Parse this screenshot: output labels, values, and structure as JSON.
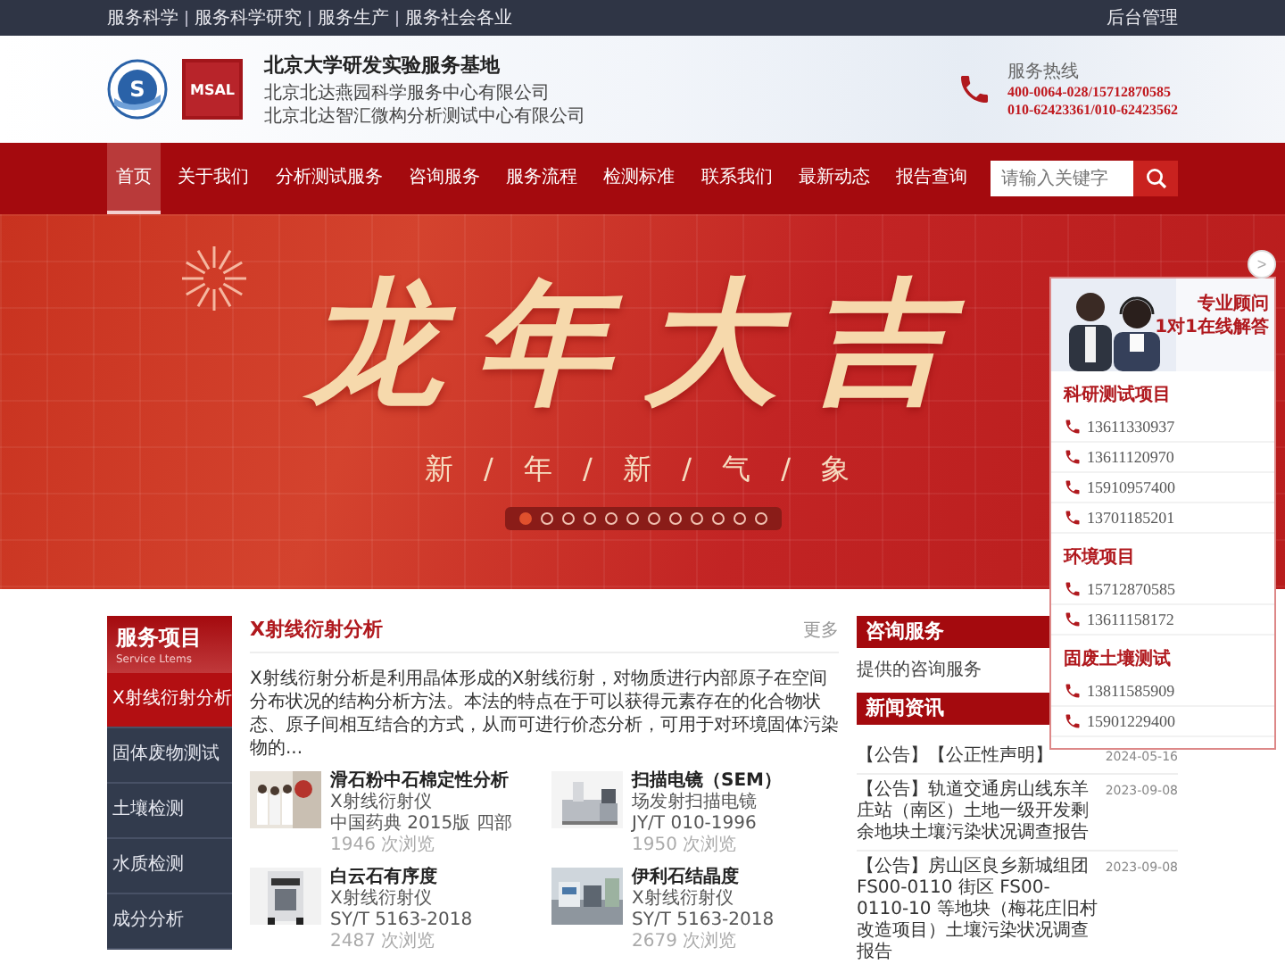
{
  "top_bar": {
    "links": [
      "服务科学",
      "服务科学研究",
      "服务生产",
      "服务社会各业"
    ],
    "admin_link": "后台管理"
  },
  "header": {
    "emblem_letter": "S",
    "logo_text": "MSAL",
    "title": "北京大学研发实验服务基地",
    "companies": [
      "北京北达燕园科学服务中心有限公司",
      "北京北达智汇微构分析测试中心有限公司"
    ],
    "hotline": {
      "label": "服务热线",
      "numbers": [
        "400-0064-028/15712870585",
        "010-62423361/010-62423562"
      ]
    }
  },
  "nav": {
    "items": [
      {
        "label": "首页",
        "selected": true
      },
      {
        "label": "关于我们",
        "selected": false
      },
      {
        "label": "分析测试服务",
        "selected": false
      },
      {
        "label": "咨询服务",
        "selected": false
      },
      {
        "label": "服务流程",
        "selected": false
      },
      {
        "label": "检测标准",
        "selected": false
      },
      {
        "label": "联系我们",
        "selected": false
      },
      {
        "label": "最新动态",
        "selected": false
      },
      {
        "label": "报告查询",
        "selected": false
      }
    ],
    "search": {
      "placeholder": "请输入关键字"
    }
  },
  "banner": {
    "headline": "龙年大吉",
    "subtitle": "新 / 年 / 新 / 气 / 象",
    "slides": [
      {
        "selected": true
      },
      {
        "selected": false
      },
      {
        "selected": false
      },
      {
        "selected": false
      },
      {
        "selected": false
      },
      {
        "selected": false
      },
      {
        "selected": false
      },
      {
        "selected": false
      },
      {
        "selected": false
      },
      {
        "selected": false
      },
      {
        "selected": false
      },
      {
        "selected": false
      }
    ]
  },
  "sidebar": {
    "title": "服务项目",
    "subtitle": "Service Ltems",
    "items": [
      {
        "label": "X射线衍射分析",
        "selected": true
      },
      {
        "label": "固体废物测试",
        "selected": false
      },
      {
        "label": "土壤检测",
        "selected": false
      },
      {
        "label": "水质检测",
        "selected": false
      },
      {
        "label": "成分分析",
        "selected": false
      }
    ]
  },
  "article": {
    "title": "X射线衍射分析",
    "more": "更多",
    "summary": "X射线衍射分析是利用晶体形成的X射线衍射，对物质进行内部原子在空间分布状况的结构分析方法。本法的特点在于可以获得元素存在的化合物状态、原子间相互结合的方式，从而可进行价态分析，可用于对环境固体污染物的...",
    "cards": [
      {
        "title": "滑石粉中石棉定性分析",
        "instrument": "X射线衍射仪",
        "standard": "中国药典 2015版 四部",
        "views": "1946 次浏览"
      },
      {
        "title": "扫描电镜（SEM）",
        "instrument": "场发射扫描电镜",
        "standard": "JY/T 010-1996",
        "views": "1950 次浏览"
      },
      {
        "title": "白云石有序度",
        "instrument": "X射线衍射仪",
        "standard": "SY/T 5163-2018",
        "views": "2487 次浏览"
      },
      {
        "title": "伊利石结晶度",
        "instrument": "X射线衍射仪",
        "standard": "SY/T 5163-2018",
        "views": "2679 次浏览"
      }
    ]
  },
  "consult": {
    "title": "咨询服务",
    "text": "提供的咨询服务"
  },
  "news": {
    "title": "新闻资讯",
    "items": [
      {
        "text": "【公告】【公正性声明】",
        "date": "2024-05-16"
      },
      {
        "text": "【公告】轨道交通房山线东羊庄站（南区）土地一级开发剩余地块土壤污染状况调查报告",
        "date": "2023-09-08"
      },
      {
        "text": "【公告】房山区良乡新城组团 FS00-0110 街区 FS00-0110-10 等地块（梅花庄旧村改造项目）土壤污染状况调查报告",
        "date": "2023-09-08"
      }
    ]
  },
  "float_panel": {
    "close": ">",
    "headline": [
      "专业顾问",
      "1对1在线解答"
    ],
    "groups": [
      {
        "title": "科研测试项目",
        "phones": [
          "13611330937",
          "13611120970",
          "15910957400",
          "13701185201"
        ]
      },
      {
        "title": "环境项目",
        "phones": [
          "15712870585",
          "13611158172"
        ]
      },
      {
        "title": "固废土壤测试",
        "phones": [
          "13811585909",
          "15901229400"
        ]
      }
    ]
  }
}
